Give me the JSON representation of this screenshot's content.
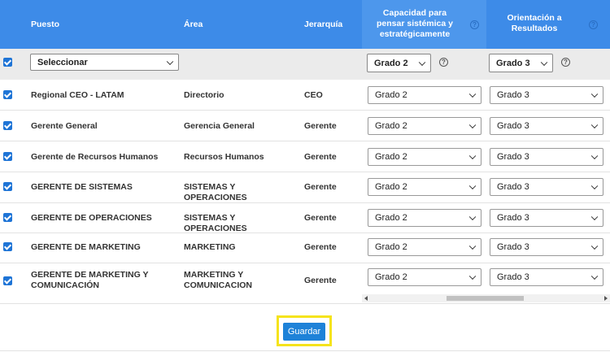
{
  "header": {
    "puesto": "Puesto",
    "area": "Área",
    "jerarquia": "Jerarquía",
    "capacidad": "Capacidad para pensar sistémica y estratégicamente",
    "orientacion": "Orientación a Resultados",
    "help_glyph": "?"
  },
  "filter": {
    "position_select": "Seleccionar",
    "capacidad_grade": "Grado 2",
    "orientacion_grade": "Grado 3",
    "help_glyph": "?"
  },
  "rows": [
    {
      "puesto": "Regional CEO - LATAM",
      "area": "Directorio",
      "jerarquia": "CEO",
      "capacidad": "Grado 2",
      "orientacion": "Grado 3"
    },
    {
      "puesto": "Gerente General",
      "area": "Gerencia General",
      "jerarquia": "Gerente",
      "capacidad": "Grado 2",
      "orientacion": "Grado 3"
    },
    {
      "puesto": "Gerente de Recursos Humanos",
      "area": "Recursos Humanos",
      "jerarquia": "Gerente",
      "capacidad": "Grado 2",
      "orientacion": "Grado 3"
    },
    {
      "puesto": "GERENTE DE SISTEMAS",
      "area": "SISTEMAS Y OPERACIONES",
      "jerarquia": "Gerente",
      "capacidad": "Grado 2",
      "orientacion": "Grado 3"
    },
    {
      "puesto": "GERENTE DE OPERACIONES",
      "area": "SISTEMAS Y OPERACIONES",
      "jerarquia": "Gerente",
      "capacidad": "Grado 2",
      "orientacion": "Grado 3"
    },
    {
      "puesto": "GERENTE DE MARKETING",
      "area": "MARKETING",
      "jerarquia": "Gerente",
      "capacidad": "Grado 2",
      "orientacion": "Grado 3"
    },
    {
      "puesto": "GERENTE DE MARKETING Y COMUNICACIÓN",
      "area": "MARKETING Y COMUNICACION",
      "jerarquia": "Gerente",
      "capacidad": "Grado 2",
      "orientacion": "Grado 3"
    }
  ],
  "actions": {
    "save_label": "Guardar"
  },
  "colors": {
    "header_blue": "#3d8be8",
    "checkbox_blue": "#1e74d6",
    "save_button": "#1e82d8",
    "highlight": "#f5e31c"
  }
}
